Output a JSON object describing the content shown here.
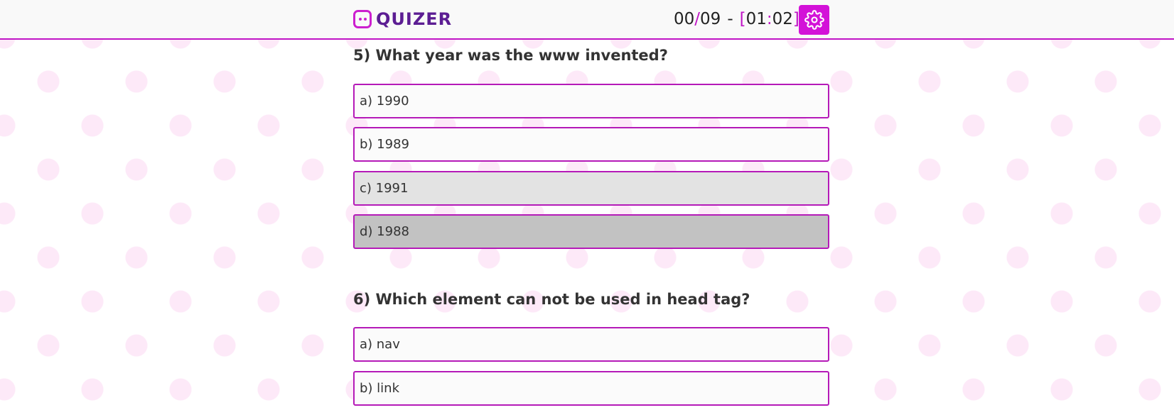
{
  "app": {
    "name": "QUIZER"
  },
  "timer": {
    "answered": "00",
    "slash": "/",
    "total": "09",
    "separator": "-",
    "open_bracket": "[",
    "minutes": "01",
    "colon": ":",
    "seconds": "02",
    "close_bracket": "]"
  },
  "settings_icon": "gear-icon",
  "colors": {
    "accent": "#c014c6",
    "brand_text": "#5c1d93",
    "button": "#d312d8"
  },
  "questions": [
    {
      "title": "5) What year was the www invented?",
      "options": [
        "a) 1990",
        "b) 1989",
        "c) 1991",
        "d) 1988"
      ]
    },
    {
      "title": "6) Which element can not be used in head tag?",
      "options": [
        "a) nav",
        "b) link"
      ]
    }
  ]
}
